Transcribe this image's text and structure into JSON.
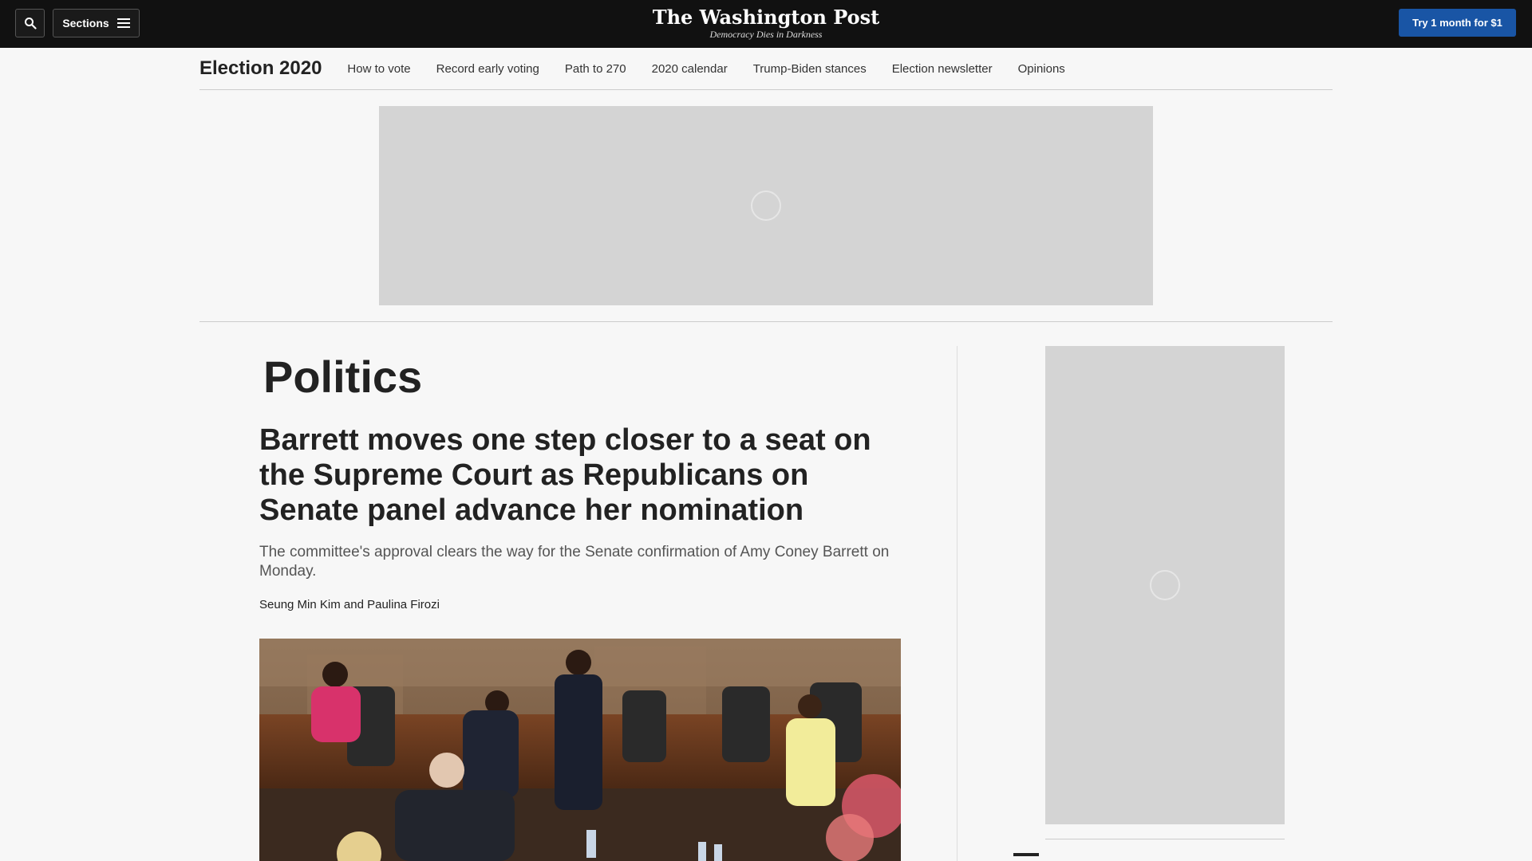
{
  "topbar": {
    "search_icon": "search-icon",
    "sections_label": "Sections",
    "menu_icon": "hamburger-menu-icon",
    "logo": "The Washington Post",
    "tagline": "Democracy Dies in Darkness",
    "cta_label": "Try 1 month for $1",
    "cta_color": "#1955a5"
  },
  "election_nav": {
    "title": "Election 2020",
    "links": [
      "How to vote",
      "Record early voting",
      "Path to 270",
      "2020 calendar",
      "Trump-Biden stances",
      "Election newsletter",
      "Opinions"
    ]
  },
  "article": {
    "section": "Politics",
    "headline": "Barrett moves one step closer to a seat on the Supreme Court as Republicans on Senate panel advance her nomination",
    "dek": "The committee's approval clears the way for the Senate confirmation of Amy Coney Barrett on Monday.",
    "authors": [
      "Seung Min Kim",
      "Paulina Firozi"
    ],
    "author_joiner": "and"
  }
}
